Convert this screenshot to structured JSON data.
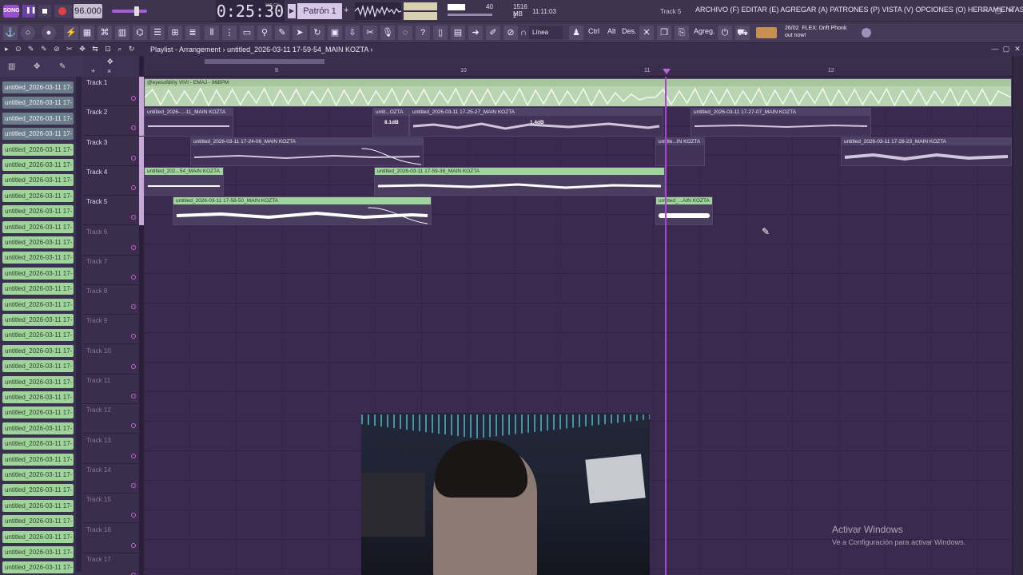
{
  "topbar": {
    "logo": "SONG",
    "tempo": "96.000",
    "time": "0:25:30",
    "time_unit": "M:S:CS",
    "pattern": "Patrón 1",
    "pattern_add": "+",
    "cpu_val": "40",
    "mem": "1516 MB",
    "poly": "2",
    "clock": "11:11:03",
    "selected_track": "Track 5",
    "menu": "ARCHIVO (F) EDITAR (E) AGREGAR (A) PATRONES (P) VISTA (V) OPCIONES (O) HERRAMIENTAS (T) AYUDA",
    "win_min": "—",
    "win_max": "▢",
    "win_close": "✕"
  },
  "toolbar": {
    "snap": "Línea",
    "ctrl": "Ctrl",
    "alt": "Alt",
    "des": "Des.",
    "agreg": "Agreg.",
    "flex_date": "26/02",
    "flex_title": "FLEX: Drift Phonk",
    "flex_sub": "out now!"
  },
  "playlist": {
    "title": "Playlist - Arrangement",
    "separator": "›",
    "current": "untitled_2026-03-11 17-59-54_MAIN KOZTA",
    "end_sep": "›"
  },
  "ruler": {
    "bars": [
      "9",
      "10",
      "11",
      "12"
    ]
  },
  "browser_items": [
    {
      "label": "untitled_2026-03-11 17-",
      "style": "dark"
    },
    {
      "label": "untitled_2026-03-11 17-",
      "style": "dark"
    },
    {
      "label": "untitled_2026-03-11 17-",
      "style": "dark"
    },
    {
      "label": "untitled_2026-03-11 17-",
      "style": "dark"
    },
    {
      "label": "untitled_2026-03-11 17-",
      "style": "green"
    },
    {
      "label": "untitled_2026-03-11 17-",
      "style": "green"
    },
    {
      "label": "untitled_2026-03-11 17-",
      "style": "green"
    },
    {
      "label": "untitled_2026-03-11 17-",
      "style": "green"
    },
    {
      "label": "untitled_2026-03-11 17-",
      "style": "green"
    },
    {
      "label": "untitled_2026-03-11 17-",
      "style": "green"
    },
    {
      "label": "untitled_2026-03-11 17-",
      "style": "green"
    },
    {
      "label": "untitled_2026-03-11 17-",
      "style": "green"
    },
    {
      "label": "untitled_2026-03-11 17-",
      "style": "green"
    },
    {
      "label": "untitled_2026-03-11 17-",
      "style": "green"
    },
    {
      "label": "untitled_2026-03-11 17-",
      "style": "green"
    },
    {
      "label": "untitled_2026-03-11 17-",
      "style": "green"
    },
    {
      "label": "untitled_2026-03-11 17-",
      "style": "green"
    },
    {
      "label": "untitled_2026-03-11 17-",
      "style": "green"
    },
    {
      "label": "untitled_2026-03-11 17-",
      "style": "green"
    },
    {
      "label": "untitled_2026-03-11 17-",
      "style": "green"
    },
    {
      "label": "untitled_2026-03-11 17-",
      "style": "green"
    },
    {
      "label": "untitled_2026-03-11 17-",
      "style": "green"
    },
    {
      "label": "untitled_2026-03-11 17-",
      "style": "green"
    },
    {
      "label": "untitled_2026-03-11 17-",
      "style": "green"
    },
    {
      "label": "untitled_2026-03-11 17-",
      "style": "green"
    },
    {
      "label": "untitled_2026-03-11 17-",
      "style": "green"
    },
    {
      "label": "untitled_2026-03-11 17-",
      "style": "green"
    },
    {
      "label": "untitled_2026-03-11 17-",
      "style": "green"
    },
    {
      "label": "untitled_2026-03-11 17-",
      "style": "green"
    },
    {
      "label": "untitled_2026-03-11 17-",
      "style": "green"
    },
    {
      "label": "untitled_2026-03-11 17-",
      "style": "green"
    },
    {
      "label": "untitled_2026-03-11 17-",
      "style": "green"
    },
    {
      "label": "untitled_2026-03-11 17-",
      "style": "green"
    }
  ],
  "tracks": [
    "Track 1",
    "Track 2",
    "Track 3",
    "Track 4",
    "Track 5",
    "Track 6",
    "Track 7",
    "Track 8",
    "Track 9",
    "Track 10",
    "Track 11",
    "Track 12",
    "Track 13",
    "Track 14",
    "Track 15",
    "Track 16",
    "Track 17"
  ],
  "clips": {
    "t1": {
      "title": "@eyesofdirty VIVI - EMAJ - 96BPM"
    },
    "t2a": {
      "title": "untitled_2026-...-11_MAIN KOZTA"
    },
    "t2b": {
      "title": "untit...OZTA"
    },
    "t2c": {
      "title": "untitled_2026-03-11 17-25-27_MAIN KOZTA"
    },
    "t2d": {
      "title": "untitled_2026-03-11 17-27-07_MAIN KOZTA"
    },
    "t2_db1": "8.1dB",
    "t2_db2": "1.4dB",
    "t3a": {
      "title": "untitled_2026-03-11 17-24-06_MAIN KOZTA"
    },
    "t3b": {
      "title": "untitle...IN KOZTA"
    },
    "t3c": {
      "title": "untitled_2026-03-11 17-28-23_MAIN KOZTA"
    },
    "t4a": {
      "title": "untitled_202...54_MAIN KOZTA"
    },
    "t4b": {
      "title": "untitled_2026-03-11 17-59-38_MAIN KOZTA"
    },
    "t5a": {
      "title": "untitled_2026-03-11 17-58-50_MAIN KOZTA"
    },
    "t5b": {
      "title": "untitled_...AIN KOZTA"
    }
  },
  "watermark": {
    "title": "Activar Windows",
    "sub": "Ve a Configuración para activar Windows."
  },
  "colors": {
    "accent": "#b040e0",
    "clip_green": "#9fd49a",
    "background": "#3a2a50"
  }
}
